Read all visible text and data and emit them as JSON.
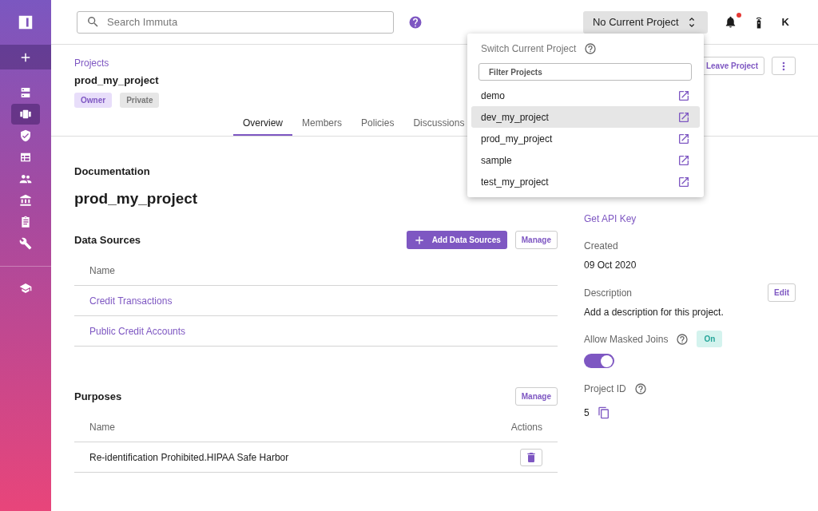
{
  "sidebar": {
    "items": [
      {
        "selected": false
      },
      {
        "selected": true
      },
      {
        "selected": false
      },
      {
        "selected": false
      },
      {
        "selected": false
      },
      {
        "selected": false
      },
      {
        "selected": false
      },
      {
        "selected": false
      }
    ]
  },
  "topbar": {
    "search": {
      "placeholder": "Search Immuta"
    },
    "project_selector": "No Current Project",
    "notifications": {
      "unread": true
    },
    "avatar": "K"
  },
  "project_menu": {
    "title": "Switch Current Project",
    "filter": {
      "placeholder": "Filter Projects"
    },
    "items": [
      {
        "label": "demo",
        "selected": false
      },
      {
        "label": "dev_my_project",
        "selected": true
      },
      {
        "label": "prod_my_project",
        "selected": false
      },
      {
        "label": "sample",
        "selected": false
      },
      {
        "label": "test_my_project",
        "selected": false
      }
    ]
  },
  "header": {
    "breadcrumb": "Projects",
    "title": "prod_my_project",
    "tags": [
      {
        "label": "Owner",
        "kind": "role"
      },
      {
        "label": "Private",
        "kind": "visibility"
      }
    ],
    "leave_button": "Leave Project"
  },
  "tabs": [
    {
      "label": "Overview",
      "selected": true
    },
    {
      "label": "Members",
      "selected": false
    },
    {
      "label": "Policies",
      "selected": false
    },
    {
      "label": "Discussions",
      "selected": false
    }
  ],
  "documentation": {
    "heading": "Documentation",
    "title": "prod_my_project"
  },
  "data_sources": {
    "heading": "Data Sources",
    "add_button": "Add Data Sources",
    "manage_button": "Manage",
    "columns": [
      "Name"
    ],
    "rows": [
      "Credit Transactions",
      "Public Credit Accounts"
    ]
  },
  "purposes": {
    "heading": "Purposes",
    "manage_button": "Manage",
    "columns": [
      "Name",
      "Actions"
    ],
    "rows": [
      "Re-identification Prohibited.HIPAA Safe Harbor"
    ]
  },
  "details": {
    "api_key_link": "Get API Key",
    "created_label": "Created",
    "created": "09 Oct 2020",
    "description_label": "Description",
    "edit_button": "Edit",
    "description": "Add a description for this project.",
    "masked_joins_label": "Allow Masked Joins",
    "masked_joins_badge": "On",
    "masked_joins_on": true,
    "project_id_label": "Project ID",
    "project_id": "5"
  }
}
